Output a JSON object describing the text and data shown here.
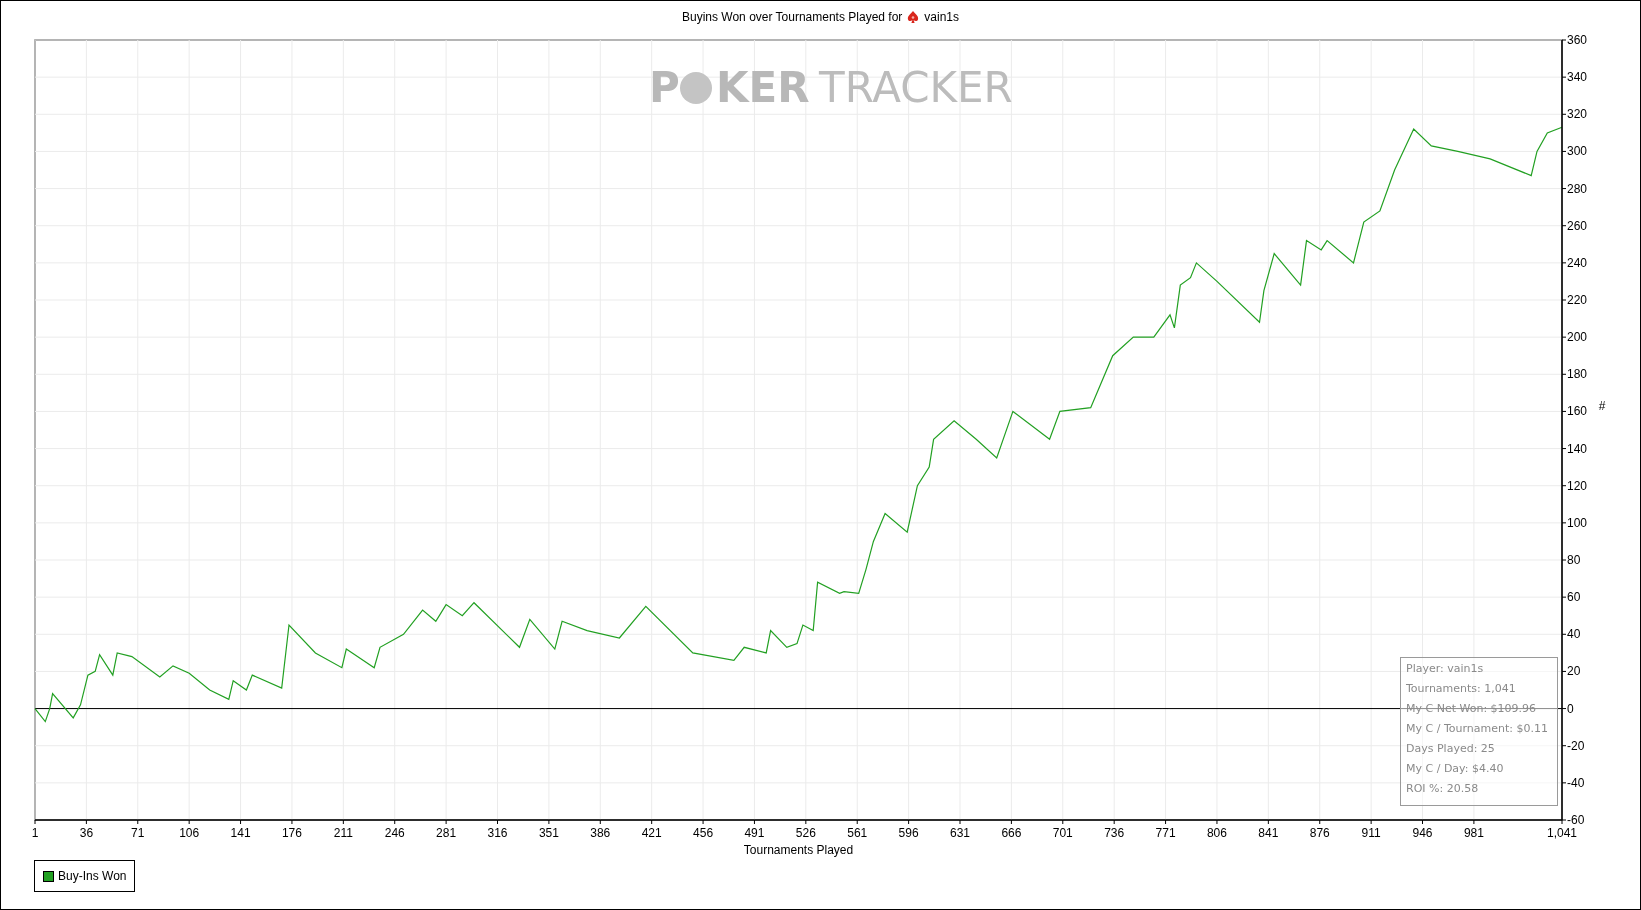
{
  "title": {
    "text": "Buyins Won over Tournaments Played for",
    "player": "vain1s"
  },
  "logo_parts": [
    "P",
    "KER",
    "TRACKER"
  ],
  "chart_data": {
    "type": "line",
    "xlabel": "Tournaments Played",
    "ylabel": "#",
    "x": [
      1,
      8,
      11,
      13,
      27,
      32,
      37,
      42,
      45,
      54,
      57,
      67,
      86,
      95,
      106,
      120,
      133,
      136,
      145,
      149,
      169,
      174,
      192,
      210,
      213,
      232,
      236,
      252,
      265,
      274,
      281,
      292,
      300,
      331,
      338,
      355,
      360,
      377,
      399,
      417,
      449,
      477,
      484,
      499,
      502,
      513,
      520,
      524,
      531,
      534,
      549,
      552,
      562,
      567,
      572,
      580,
      595,
      602,
      610,
      613,
      627,
      642,
      656,
      667,
      692,
      699,
      720,
      735,
      749,
      763,
      774,
      777,
      781,
      788,
      792,
      806,
      835,
      838,
      845,
      863,
      867,
      877,
      881,
      899,
      906,
      917,
      927,
      940,
      952,
      970,
      992,
      1020,
      1024,
      1031,
      1041
    ],
    "series": [
      {
        "name": "Buy-Ins Won",
        "color": "#22a022",
        "values": [
          0,
          -7,
          0,
          8,
          -5,
          2,
          18,
          20,
          29,
          18,
          30,
          28,
          17,
          23,
          19,
          10,
          5,
          15,
          10,
          18,
          11,
          45,
          30,
          22,
          32,
          22,
          33,
          40,
          53,
          47,
          56,
          50,
          57,
          33,
          48,
          32,
          47,
          42,
          38,
          55,
          30,
          26,
          33,
          30,
          42,
          33,
          35,
          45,
          42,
          68,
          62,
          63,
          62,
          75,
          90,
          105,
          95,
          120,
          130,
          145,
          155,
          145,
          135,
          160,
          145,
          160,
          162,
          190,
          200,
          200,
          212,
          205,
          228,
          232,
          240,
          230,
          208,
          225,
          245,
          228,
          252,
          247,
          252,
          240,
          262,
          268,
          290,
          312,
          303,
          300,
          296,
          287,
          300,
          310,
          313
        ]
      }
    ],
    "grid": true,
    "xlim": [
      1,
      1041
    ],
    "ylim": [
      -60,
      360
    ],
    "xticks": [
      1,
      36,
      71,
      106,
      141,
      176,
      211,
      246,
      281,
      316,
      351,
      386,
      421,
      456,
      491,
      526,
      561,
      596,
      631,
      666,
      701,
      736,
      771,
      806,
      841,
      876,
      911,
      946,
      981,
      {
        "value": 1041,
        "label": "1,041"
      }
    ],
    "yticks": [
      -60,
      -40,
      -20,
      0,
      20,
      40,
      60,
      80,
      100,
      120,
      140,
      160,
      180,
      200,
      220,
      240,
      260,
      280,
      300,
      320,
      340,
      360
    ]
  },
  "stats": [
    "Player: vain1s",
    "Tournaments: 1,041",
    "My C Net Won: $109.96",
    "My C / Tournament: $0.11",
    "Days Played: 25",
    "My C / Day: $4.40",
    "ROI %: 20.58"
  ]
}
